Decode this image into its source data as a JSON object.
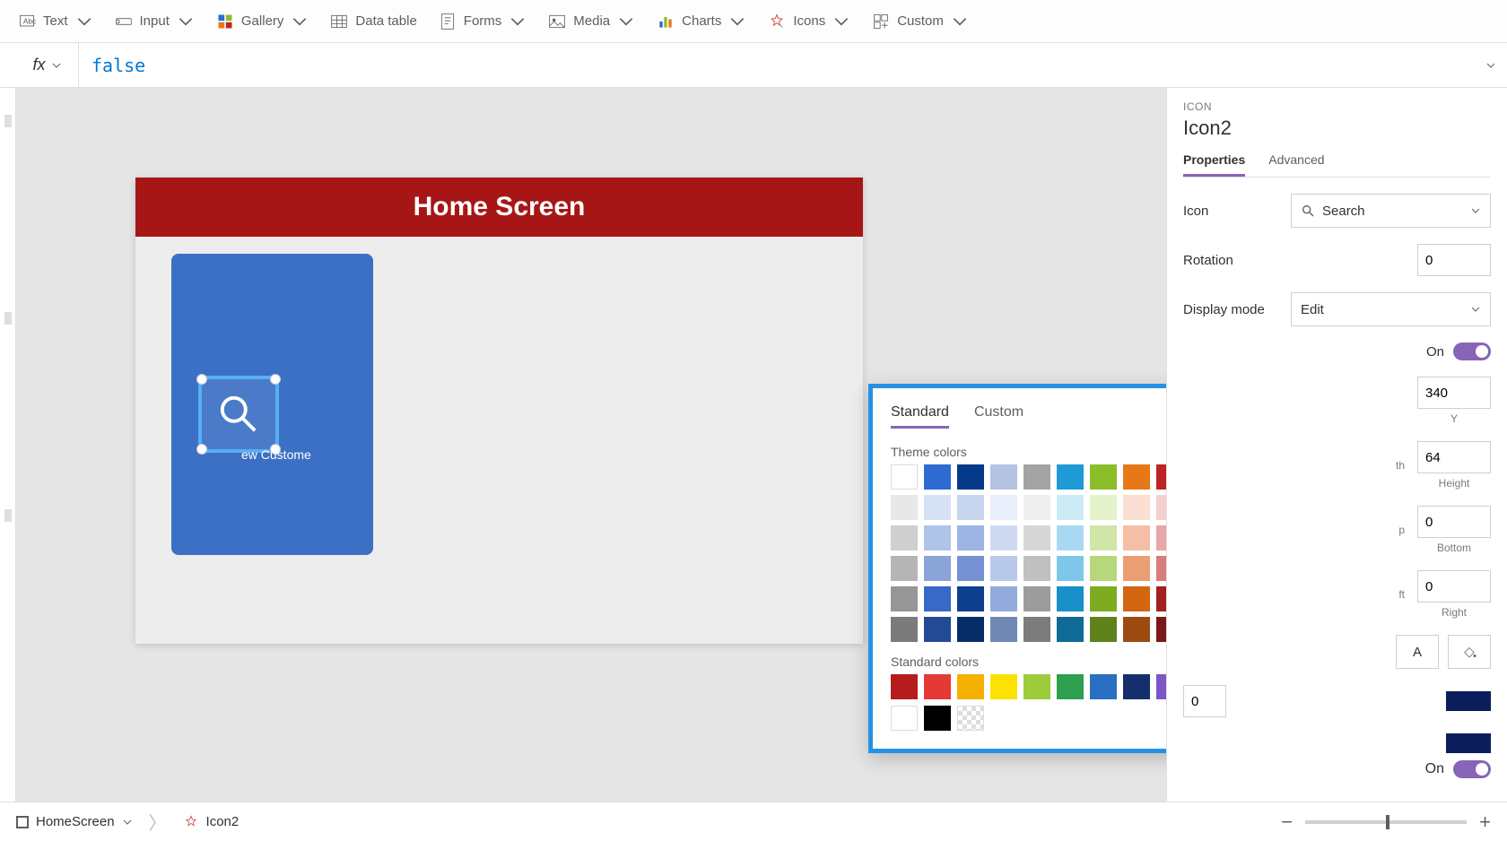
{
  "toolbar": {
    "text": "Text",
    "input": "Input",
    "gallery": "Gallery",
    "data_table": "Data table",
    "forms": "Forms",
    "media": "Media",
    "charts": "Charts",
    "icons": "Icons",
    "custom": "Custom"
  },
  "formula": {
    "prefix": "fx",
    "value": "false"
  },
  "canvas": {
    "screen_title": "Home Screen",
    "icon_caption": "ew Custome"
  },
  "props": {
    "type": "ICON",
    "name": "Icon2",
    "tabs": {
      "properties": "Properties",
      "advanced": "Advanced"
    },
    "icon_label": "Icon",
    "icon_value": "Search",
    "rotation_label": "Rotation",
    "rotation_value": "0",
    "display_mode_label": "Display mode",
    "display_mode_value": "Edit",
    "visible_on": "On",
    "y_label": "Y",
    "y_value": "340",
    "height_label": "Height",
    "height_value": "64",
    "p_label": "p",
    "bottom_label": "Bottom",
    "bottom_value": "0",
    "top_value": "0",
    "ft_label": "ft",
    "right_label": "Right",
    "left_val": "0",
    "a_label": "A",
    "color_swatch_1": "#0b1e5b",
    "color_swatch_2": "#0b1e5b"
  },
  "color_picker": {
    "tab_standard": "Standard",
    "tab_custom": "Custom",
    "theme_label": "Theme colors",
    "standard_label": "Standard colors",
    "theme_rows": [
      [
        "#ffffff",
        "#2e6bd1",
        "#053a8a",
        "#b2c4e2",
        "#a3a3a3",
        "#1e9ad6",
        "#8cbe29",
        "#e77817",
        "#bf2424",
        "#ffffff"
      ],
      [
        "#e8e8e8",
        "#d6e1f5",
        "#c8d5ee",
        "#e8eefa",
        "#eeeeee",
        "#cdeaf7",
        "#e4f2cc",
        "#fadfd2",
        "#f3cfcf",
        "#ffffff"
      ],
      [
        "#cfcfcf",
        "#b0c3e8",
        "#9eb4e2",
        "#cfdaf2",
        "#d7d7d7",
        "#a9d9f2",
        "#cfe6a8",
        "#f4bfa6",
        "#e8a7a7",
        "#ffffff"
      ],
      [
        "#b5b5b5",
        "#8ba4d8",
        "#7591d4",
        "#b9c9ea",
        "#c0c0c0",
        "#7fc7e8",
        "#b6d87a",
        "#ec9e73",
        "#d77d7d",
        "#ffffff"
      ],
      [
        "#969696",
        "#3869c7",
        "#0d3f8e",
        "#92abdc",
        "#9c9c9c",
        "#1990c7",
        "#7eac20",
        "#d36611",
        "#a32020",
        "#ffffff"
      ],
      [
        "#7b7b7b",
        "#234a94",
        "#062d68",
        "#6f89b4",
        "#7c7c7c",
        "#0f6a97",
        "#5f831a",
        "#9d4b10",
        "#7c1818",
        "#ffffff"
      ]
    ],
    "standard_row": [
      "#b71c1c",
      "#e53935",
      "#f6b100",
      "#fbe200",
      "#9ccc3c",
      "#2e9e4f",
      "#2a6fc1",
      "#142f6b",
      "#7c56c4"
    ],
    "extra_row": [
      "#ffffff",
      "#000000",
      "trans"
    ]
  },
  "footer": {
    "screen": "HomeScreen",
    "element": "Icon2",
    "on_label": "On"
  }
}
